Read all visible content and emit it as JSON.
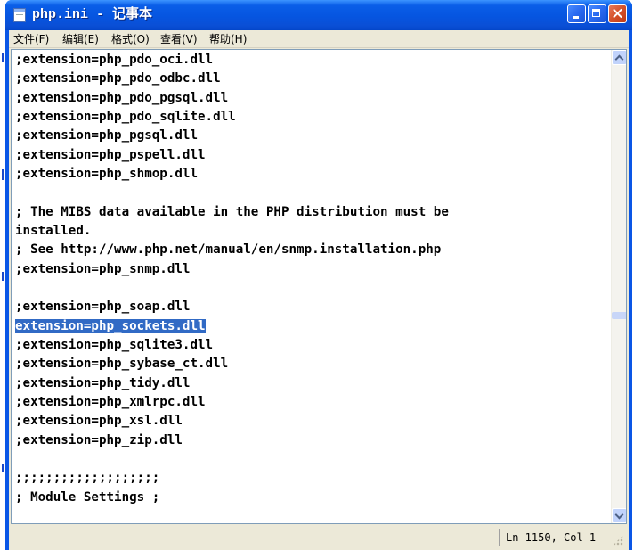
{
  "window": {
    "title": "php.ini - 记事本"
  },
  "menu": [
    "文件(F)",
    "编辑(E)",
    "格式(O)",
    "查看(V)",
    "帮助(H)"
  ],
  "editor": {
    "lines": [
      ";extension=php_pdo_oci.dll",
      ";extension=php_pdo_odbc.dll",
      ";extension=php_pdo_pgsql.dll",
      ";extension=php_pdo_sqlite.dll",
      ";extension=php_pgsql.dll",
      ";extension=php_pspell.dll",
      ";extension=php_shmop.dll",
      "",
      "; The MIBS data available in the PHP distribution must be",
      "installed.",
      "; See http://www.php.net/manual/en/snmp.installation.php",
      ";extension=php_snmp.dll",
      "",
      ";extension=php_soap.dll",
      "extension=php_sockets.dll",
      ";extension=php_sqlite3.dll",
      ";extension=php_sybase_ct.dll",
      ";extension=php_tidy.dll",
      ";extension=php_xmlrpc.dll",
      ";extension=php_xsl.dll",
      ";extension=php_zip.dll",
      "",
      ";;;;;;;;;;;;;;;;;;;",
      "; Module Settings ;"
    ],
    "selected_line": 15
  },
  "status": {
    "position": "Ln 1150, Col 1"
  },
  "colors": {
    "titlebar": "#0a5ee8",
    "selection": "#316ac5",
    "chrome": "#ece9d8"
  },
  "icons": [
    "notepad-app-icon",
    "minimize-icon",
    "maximize-icon",
    "close-icon",
    "scroll-up-icon",
    "scroll-down-icon",
    "resize-grip-icon"
  ]
}
